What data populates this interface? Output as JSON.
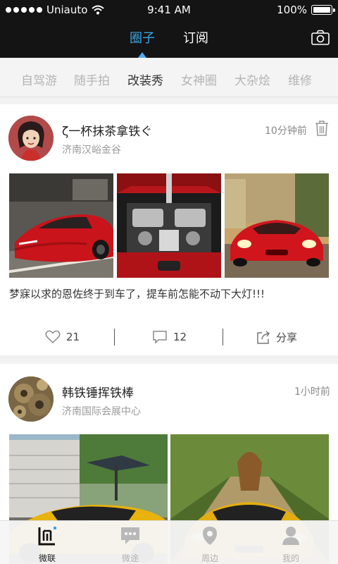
{
  "status_bar": {
    "carrier": "Uniauto",
    "time": "9:41 AM",
    "battery": "100%"
  },
  "header": {
    "tabs": [
      {
        "label": "圈子",
        "active": true
      },
      {
        "label": "订阅",
        "active": false
      }
    ],
    "camera_icon": "camera-icon"
  },
  "categories": [
    {
      "label": "自驾游",
      "active": false
    },
    {
      "label": "随手拍",
      "active": false
    },
    {
      "label": "改装秀",
      "active": true
    },
    {
      "label": "女神圈",
      "active": false
    },
    {
      "label": "大杂烩",
      "active": false
    },
    {
      "label": "维修",
      "active": false
    }
  ],
  "posts": [
    {
      "author": "ζ一杯抹茶拿铁ぐ",
      "location": "济南汉峪金谷",
      "time": "10分钟前",
      "text": "梦寐以求的恩佐终于到车了，提车前怎能不动下大灯!!!",
      "likes": "21",
      "comments": "12",
      "share_label": "分享"
    },
    {
      "author": "韩铁锤挥铁棒",
      "location": "济南国际会展中心",
      "time": "1小时前"
    }
  ],
  "tabbar": [
    {
      "label": "微联",
      "icon": "weilian-logo-icon",
      "active": true
    },
    {
      "label": "微途",
      "icon": "chat-bubble-icon",
      "active": false
    },
    {
      "label": "周边",
      "icon": "location-pin-icon",
      "active": false
    },
    {
      "label": "我的",
      "icon": "person-icon",
      "active": false
    }
  ],
  "colors": {
    "accent": "#38a7e8",
    "header_bg": "#141414",
    "car_red": "#c8141a",
    "car_yellow": "#e8b30c"
  }
}
